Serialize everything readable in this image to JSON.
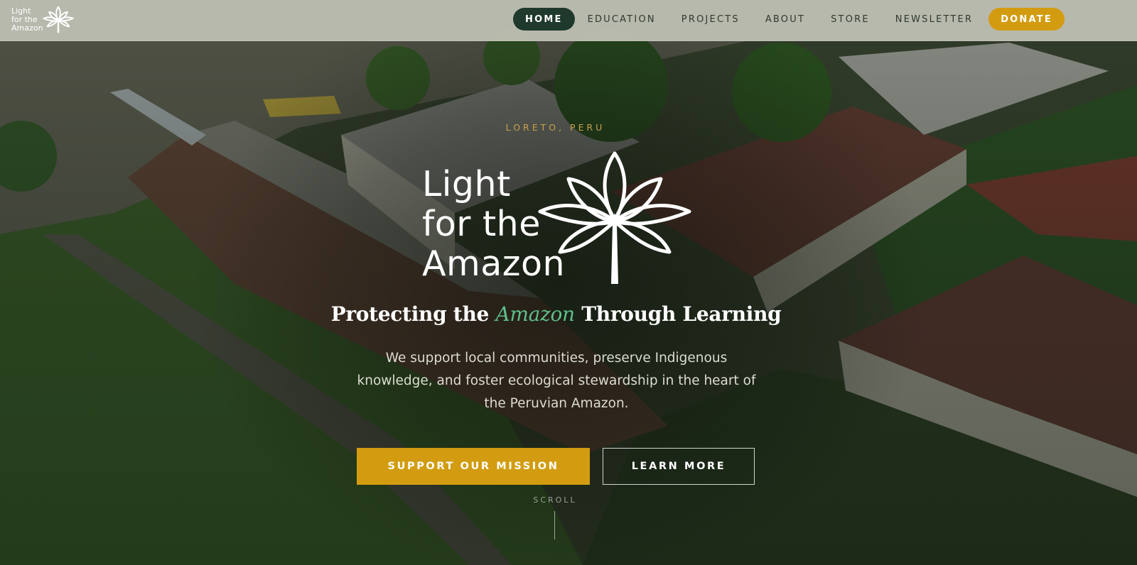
{
  "brand": {
    "name_lines": [
      "Light",
      "for the",
      "Amazon"
    ],
    "logo_icon": "leaf-star-icon"
  },
  "nav": {
    "items": [
      {
        "label": "HOME",
        "active": true
      },
      {
        "label": "EDUCATION",
        "active": false
      },
      {
        "label": "PROJECTS",
        "active": false
      },
      {
        "label": "ABOUT",
        "active": false
      },
      {
        "label": "STORE",
        "active": false
      },
      {
        "label": "NEWSLETTER",
        "active": false
      }
    ],
    "donate_label": "DONATE"
  },
  "hero": {
    "eyebrow": "LORETO, PERU",
    "logo_lines": [
      "Light",
      "for the",
      "Amazon"
    ],
    "headline_before": "Protecting the ",
    "headline_accent": "Amazon",
    "headline_after": " Through Learning",
    "subtext": "We support local communities, preserve Indigenous knowledge, and foster ecological stewardship in the heart of the Peruvian Amazon.",
    "primary_cta": "SUPPORT OUR MISSION",
    "secondary_cta": "LEARN MORE",
    "scroll_label": "SCROLL",
    "background": "aerial-village-photo"
  },
  "colors": {
    "nav_active_bg": "#1f3a2c",
    "accent_gold": "#d39c10",
    "accent_green": "#5fbf8a",
    "eyebrow_gold": "#c8a04a"
  }
}
